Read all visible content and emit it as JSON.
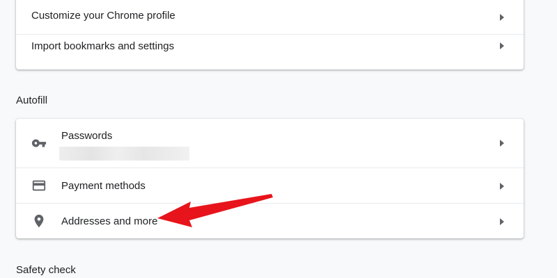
{
  "profile_card": {
    "items": [
      {
        "label": "Customize your Chrome profile"
      },
      {
        "label": "Import bookmarks and settings"
      }
    ]
  },
  "autofill": {
    "title": "Autofill",
    "items": [
      {
        "label": "Passwords",
        "icon": "key-icon"
      },
      {
        "label": "Payment methods",
        "icon": "credit-card-icon"
      },
      {
        "label": "Addresses and more",
        "icon": "location-pin-icon"
      }
    ]
  },
  "safety": {
    "title": "Safety check"
  },
  "colors": {
    "background": "#f8f9fa",
    "card": "#ffffff",
    "icon": "#5f6368",
    "annotation_arrow": "#e8141b"
  }
}
